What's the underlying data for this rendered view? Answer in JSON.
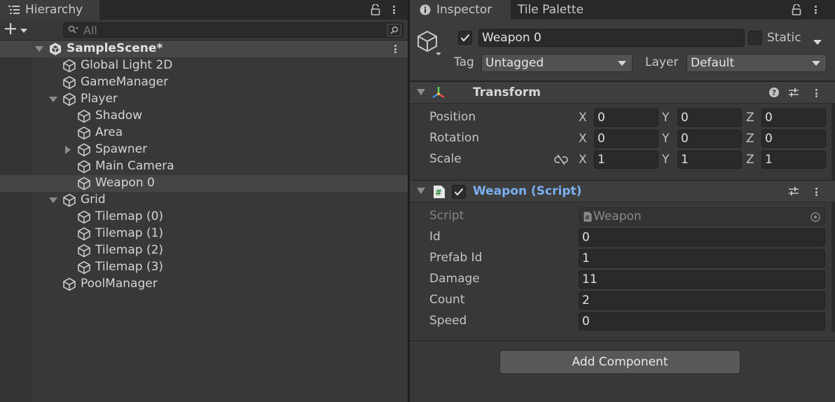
{
  "hierarchy": {
    "tab_label": "Hierarchy",
    "search_placeholder": "All",
    "scene_name": "SampleScene*",
    "items": [
      {
        "label": "Global Light 2D",
        "depth": 0,
        "arrow": "none"
      },
      {
        "label": "GameManager",
        "depth": 0,
        "arrow": "none"
      },
      {
        "label": "Player",
        "depth": 0,
        "arrow": "expanded"
      },
      {
        "label": "Shadow",
        "depth": 1,
        "arrow": "none"
      },
      {
        "label": "Area",
        "depth": 1,
        "arrow": "none"
      },
      {
        "label": "Spawner",
        "depth": 1,
        "arrow": "collapsed"
      },
      {
        "label": "Main Camera",
        "depth": 1,
        "arrow": "none"
      },
      {
        "label": "Weapon 0",
        "depth": 1,
        "arrow": "none",
        "selected": true
      },
      {
        "label": "Grid",
        "depth": 0,
        "arrow": "expanded"
      },
      {
        "label": "Tilemap (0)",
        "depth": 1,
        "arrow": "none"
      },
      {
        "label": "Tilemap (1)",
        "depth": 1,
        "arrow": "none"
      },
      {
        "label": "Tilemap (2)",
        "depth": 1,
        "arrow": "none"
      },
      {
        "label": "Tilemap (3)",
        "depth": 1,
        "arrow": "none"
      },
      {
        "label": "PoolManager",
        "depth": 0,
        "arrow": "none"
      }
    ]
  },
  "inspector": {
    "tabs": [
      "Inspector",
      "Tile Palette"
    ],
    "object_name": "Weapon 0",
    "active": true,
    "static_label": "Static",
    "tag_label": "Tag",
    "tag_value": "Untagged",
    "layer_label": "Layer",
    "layer_value": "Default",
    "transform": {
      "title": "Transform",
      "rows": [
        {
          "label": "Position",
          "x": "0",
          "y": "0",
          "z": "0"
        },
        {
          "label": "Rotation",
          "x": "0",
          "y": "0",
          "z": "0"
        },
        {
          "label": "Scale",
          "x": "1",
          "y": "1",
          "z": "1"
        }
      ],
      "axes": [
        "X",
        "Y",
        "Z"
      ]
    },
    "weapon_script": {
      "title": "Weapon (Script)",
      "script_label": "Script",
      "script_value": "Weapon",
      "fields": [
        {
          "label": "Id",
          "value": "0"
        },
        {
          "label": "Prefab Id",
          "value": "1"
        },
        {
          "label": "Damage",
          "value": "11"
        },
        {
          "label": "Count",
          "value": "2"
        },
        {
          "label": "Speed",
          "value": "0"
        }
      ]
    },
    "add_component_label": "Add Component"
  },
  "colors": {
    "script_title": "#7ab0f0",
    "panel_bg": "#383838",
    "selection_bg": "#454545"
  },
  "icons": {
    "hierarchy_tab": "list-icon",
    "inspector_tab": "info-icon",
    "lock": "lock-icon",
    "menu": "kebab-menu-icon",
    "gameobject": "cube-icon",
    "scene": "unity-scene-icon",
    "transform": "transform-axes-icon",
    "script": "csharp-script-icon",
    "help": "help-icon",
    "presets": "sliders-icon",
    "constrain": "unlinked-chain-icon",
    "object_picker": "target-icon"
  }
}
